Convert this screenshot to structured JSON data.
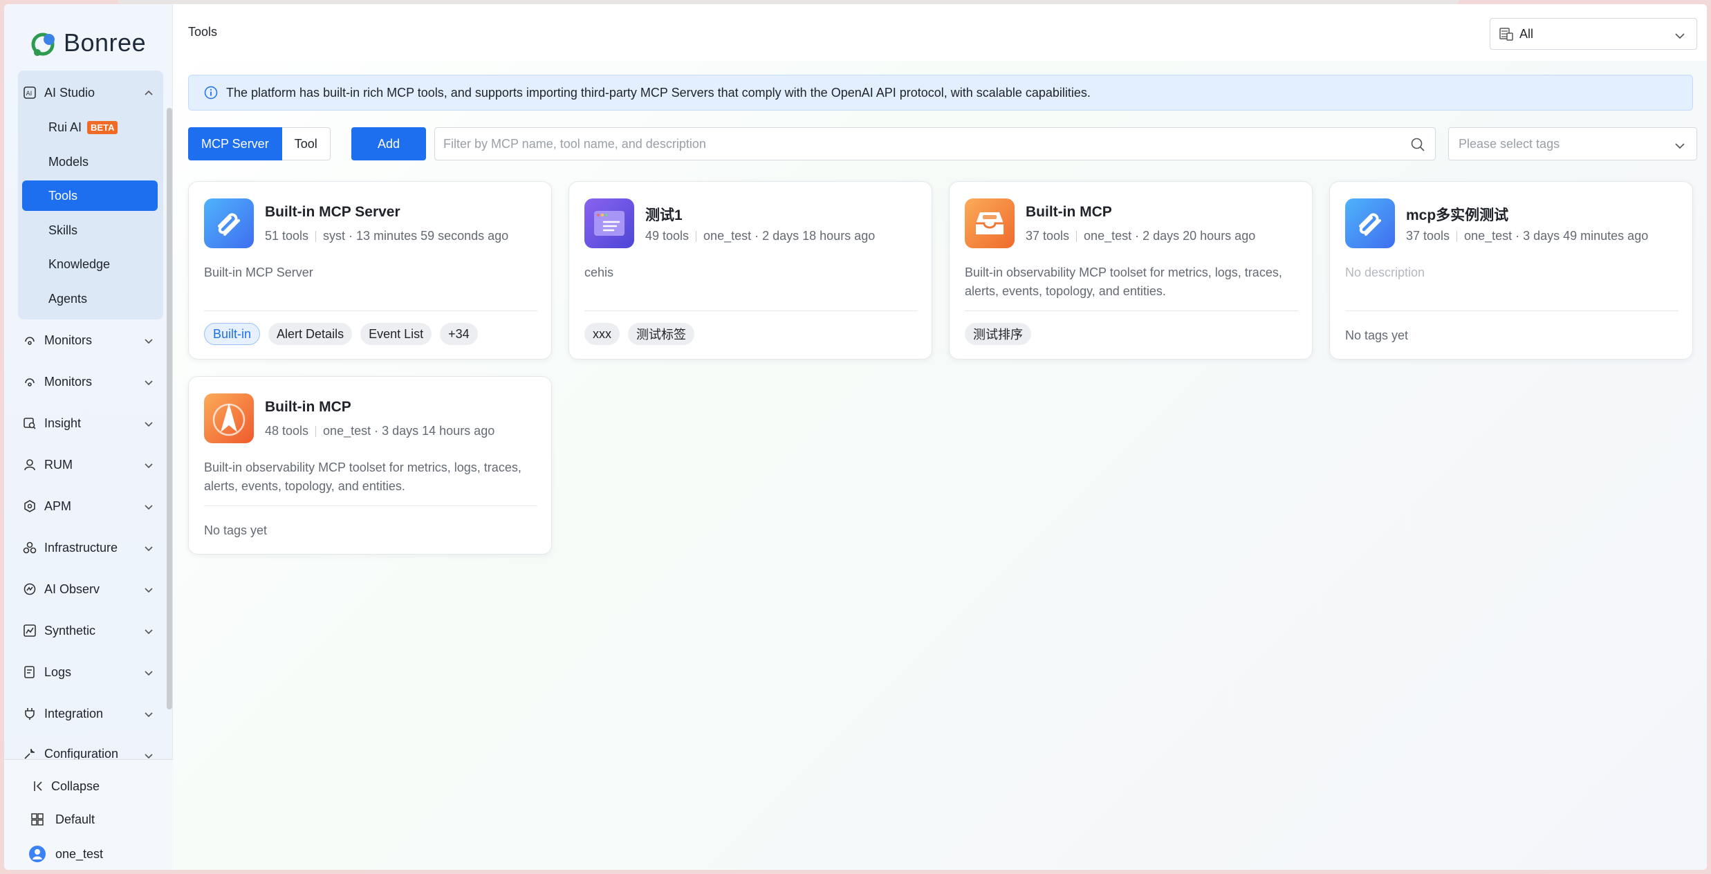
{
  "brand": {
    "name": "Bonree"
  },
  "sidebar": {
    "studio": {
      "label": "AI Studio",
      "icon": "ai-icon"
    },
    "studio_items": [
      {
        "label": "Rui AI",
        "badge": "BETA"
      },
      {
        "label": "Models"
      },
      {
        "label": "Tools",
        "active": true
      },
      {
        "label": "Skills"
      },
      {
        "label": "Knowledge"
      },
      {
        "label": "Agents"
      }
    ],
    "groups": [
      {
        "label": "Monitors",
        "icon": "monitor-icon"
      },
      {
        "label": "Monitors",
        "icon": "monitor-icon"
      },
      {
        "label": "Insight",
        "icon": "insight-icon"
      },
      {
        "label": "RUM",
        "icon": "user-icon"
      },
      {
        "label": "APM",
        "icon": "apm-icon"
      },
      {
        "label": "Infrastructure",
        "icon": "infrastructure-icon"
      },
      {
        "label": "AI Observ",
        "icon": "ai-observ-icon"
      },
      {
        "label": "Synthetic",
        "icon": "synthetic-icon"
      },
      {
        "label": "Logs",
        "icon": "logs-icon"
      },
      {
        "label": "Integration",
        "icon": "integration-icon"
      },
      {
        "label": "Configuration",
        "icon": "wrench-icon"
      }
    ],
    "bottom": {
      "collapse": "Collapse",
      "workspace": "Default",
      "user": "one_test"
    }
  },
  "header": {
    "title": "Tools",
    "scope_value": "All"
  },
  "banner": {
    "text": "The platform has built-in rich MCP tools, and supports importing third-party MCP Servers that comply with the OpenAI API protocol, with scalable capabilities."
  },
  "toolbar": {
    "tabs": [
      "MCP Server",
      "Tool"
    ],
    "active_tab": "MCP Server",
    "add_label": "Add",
    "search_placeholder": "Filter by MCP name, tool name, and description",
    "tags_placeholder": "Please select tags"
  },
  "cards": [
    {
      "name": "Built-in MCP Server",
      "tools": "51 tools",
      "owner_time": "syst · 13 minutes 59 seconds ago",
      "description": "Built-in MCP Server",
      "tags": [
        "Built-in",
        "Alert Details",
        "Event List",
        "+34"
      ],
      "icon": "link-icon",
      "color": "#3f8ef5"
    },
    {
      "name": "测试1",
      "tools": "49 tools",
      "owner_time": "one_test · 2 days 18 hours ago",
      "description": "cehis",
      "tags": [
        "xxx",
        "测试标签"
      ],
      "icon": "browser-window-icon",
      "color": "#6b54e0"
    },
    {
      "name": "Built-in MCP",
      "tools": "37 tools",
      "owner_time": "one_test · 2 days 20 hours ago",
      "description": "Built-in observability MCP toolset for metrics, logs, traces, alerts, events, topology, and entities.",
      "tags": [
        "测试排序"
      ],
      "icon": "inbox-icon",
      "color": "#f2853a"
    },
    {
      "name": "mcp多实例测试",
      "tools": "37 tools",
      "owner_time": "one_test · 3 days 49 minutes ago",
      "description": "No description",
      "no_tags": "No tags yet",
      "icon": "link-icon",
      "color": "#3f8ef5"
    },
    {
      "name": "Built-in MCP",
      "tools": "48 tools",
      "owner_time": "one_test · 3 days 14 hours ago",
      "description": "Built-in observability MCP toolset for metrics, logs, traces, alerts, events, topology, and entities.",
      "no_tags": "No tags yet",
      "icon": "compass-icon",
      "color": "#f2853a"
    }
  ]
}
